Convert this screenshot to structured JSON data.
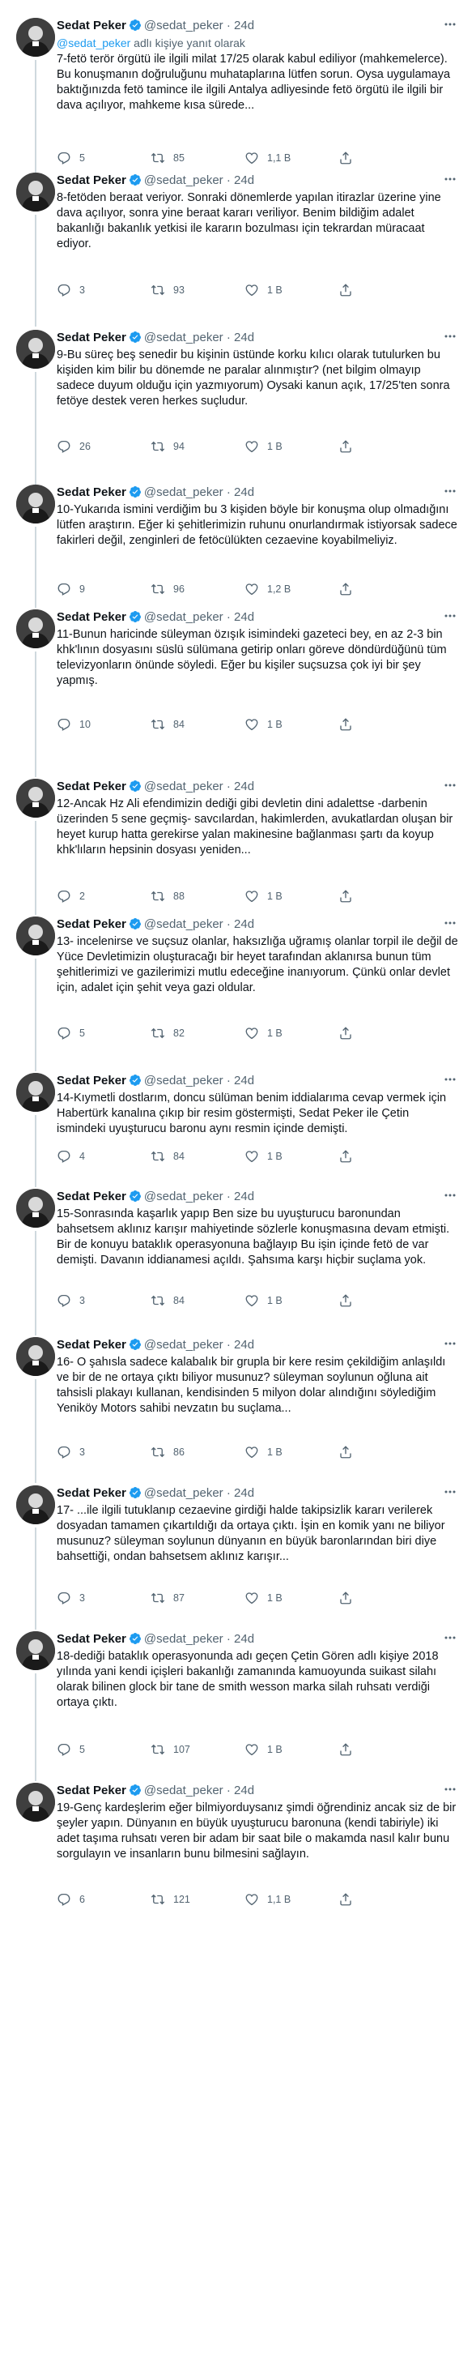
{
  "colors": {
    "accent": "#1d9bf0",
    "muted": "#536471",
    "text": "#0f1419",
    "thread_line": "#cfd9de"
  },
  "tweets": [
    {
      "name": "Sedat Peker",
      "handle": "@sedat_peker",
      "time": "24d",
      "reply_prefix": "@sedat_peker",
      "reply_suffix": " adlı kişiye yanıt olarak",
      "text": "7-fetö terör örgütü ile ilgili milat 17/25 olarak kabul ediliyor (mahkemelerce). Bu konuşmanın doğruluğunu muhataplarına lütfen sorun. Oysa uygulamaya baktığınızda fetö tamince ile ilgili Antalya adliyesinde fetö örgütü ile ilgili bir dava açılıyor, mahkeme kısa sürede...",
      "replies": "5",
      "retweets": "85",
      "likes": "1,1 B"
    },
    {
      "name": "Sedat Peker",
      "handle": "@sedat_peker",
      "time": "24d",
      "text": "8-fetöden beraat veriyor. Sonraki dönemlerde yapılan itirazlar üzerine yine dava açılıyor, sonra yine beraat kararı veriliyor. Benim bildiğim adalet bakanlığı bakanlık yetkisi ile kararın bozulması için tekrardan müracaat ediyor.",
      "replies": "3",
      "retweets": "93",
      "likes": "1 B"
    },
    {
      "name": "Sedat Peker",
      "handle": "@sedat_peker",
      "time": "24d",
      "text": "9-Bu süreç beş senedir bu kişinin üstünde korku kılıcı olarak tutulurken bu kişiden kim bilir bu dönemde ne paralar alınmıştır? (net bilgim olmayıp sadece duyum olduğu için yazmıyorum) Oysaki kanun açık, 17/25'ten sonra fetöye destek veren herkes suçludur.",
      "replies": "26",
      "retweets": "94",
      "likes": "1 B"
    },
    {
      "name": "Sedat Peker",
      "handle": "@sedat_peker",
      "time": "24d",
      "text": "10-Yukarıda ismini verdiğim bu 3 kişiden böyle bir konuşma olup olmadığını lütfen araştırın. Eğer ki şehitlerimizin ruhunu onurlandırmak istiyorsak sadece fakirleri değil, zenginleri de fetöcülükten cezaevine koyabilmeliyiz.",
      "replies": "9",
      "retweets": "96",
      "likes": "1,2 B"
    },
    {
      "name": "Sedat Peker",
      "handle": "@sedat_peker",
      "time": "24d",
      "text": "11-Bunun haricinde süleyman özışık isimindeki gazeteci bey, en az 2-3 bin khk'lının dosyasını süslü sülümana getirip onları göreve döndürdüğünü tüm televizyonların önünde söyledi. Eğer bu kişiler suçsuzsa çok iyi bir şey yapmış.",
      "replies": "10",
      "retweets": "84",
      "likes": "1 B"
    },
    {
      "name": "Sedat Peker",
      "handle": "@sedat_peker",
      "time": "24d",
      "text": "12-Ancak Hz Ali efendimizin dediği gibi devletin dini adalettse -darbenin üzerinden 5 sene geçmiş- savcılardan, hakimlerden, avukatlardan oluşan bir heyet kurup hatta gerekirse yalan makinesine bağlanması şartı da koyup khk'lıların hepsinin dosyası yeniden...",
      "replies": "2",
      "retweets": "88",
      "likes": "1 B"
    },
    {
      "name": "Sedat Peker",
      "handle": "@sedat_peker",
      "time": "24d",
      "text": "13- incelenirse ve suçsuz olanlar, haksızlığa uğramış olanlar torpil ile değil de Yüce Devletimizin oluşturacağı bir heyet tarafından aklanırsa bunun tüm şehitlerimizi ve gazilerimizi mutlu edeceğine inanıyorum. Çünkü onlar devlet için, adalet için şehit veya gazi oldular.",
      "replies": "5",
      "retweets": "82",
      "likes": "1 B"
    },
    {
      "name": "Sedat Peker",
      "handle": "@sedat_peker",
      "time": "24d",
      "text": "14-Kıymetli dostlarım, doncu sülüman benim iddialarıma cevap vermek için Habertürk kanalına çıkıp bir resim göstermişti, Sedat Peker ile Çetin ismindeki uyuşturucu baronu aynı resmin içinde demişti.",
      "replies": "4",
      "retweets": "84",
      "likes": "1 B"
    },
    {
      "name": "Sedat Peker",
      "handle": "@sedat_peker",
      "time": "24d",
      "text": "15-Sonrasında kaşarlık yapıp Ben size bu uyuşturucu baronundan bahsetsem aklınız karışır mahiyetinde sözlerle konuşmasına devam etmişti. Bir de konuyu bataklık operasyonuna bağlayıp Bu işin içinde fetö de var demişti. Davanın iddianamesi açıldı. Şahsıma karşı hiçbir suçlama yok.",
      "replies": "3",
      "retweets": "84",
      "likes": "1 B"
    },
    {
      "name": "Sedat Peker",
      "handle": "@sedat_peker",
      "time": "24d",
      "text": "16- O şahısla sadece kalabalık bir grupla bir kere resim çekildiğim anlaşıldı ve bir de ne ortaya çıktı biliyor musunuz? süleyman soylunun oğluna ait tahsisli plakayı kullanan, kendisinden 5 milyon dolar alındığını söylediğim Yeniköy Motors sahibi nevzatın bu suçlama...",
      "replies": "3",
      "retweets": "86",
      "likes": "1 B"
    },
    {
      "name": "Sedat Peker",
      "handle": "@sedat_peker",
      "time": "24d",
      "text": "17- ...ile ilgili tutuklanıp cezaevine girdiği halde takipsizlik kararı verilerek dosyadan tamamen çıkartıldığı da ortaya çıktı. İşin en komik yanı ne biliyor musunuz? süleyman soylunun dünyanın en büyük baronlarından biri diye bahsettiği, ondan bahsetsem aklınız karışır...",
      "replies": "3",
      "retweets": "87",
      "likes": "1 B"
    },
    {
      "name": "Sedat Peker",
      "handle": "@sedat_peker",
      "time": "24d",
      "text": "18-dediği bataklık operasyonunda adı geçen Çetin Gören adlı kişiye 2018 yılında yani kendi içişleri bakanlığı zamanında kamuoyunda suikast silahı olarak bilinen glock bir tane de smith wesson marka silah ruhsatı verdiği ortaya çıktı.",
      "replies": "5",
      "retweets": "107",
      "likes": "1 B"
    },
    {
      "name": "Sedat Peker",
      "handle": "@sedat_peker",
      "time": "24d",
      "text": "19-Genç kardeşlerim eğer bilmiyorduysanız şimdi öğrendiniz ancak siz de bir şeyler yapın.  Dünyanın en büyük uyuşturucu baronuna (kendi tabiriyle) iki adet taşıma ruhsatı veren bir adam bir saat bile o makamda nasıl kalır bunu sorgulayın ve insanların bunu bilmesini sağlayın.",
      "replies": "6",
      "retweets": "121",
      "likes": "1,1 B"
    }
  ]
}
